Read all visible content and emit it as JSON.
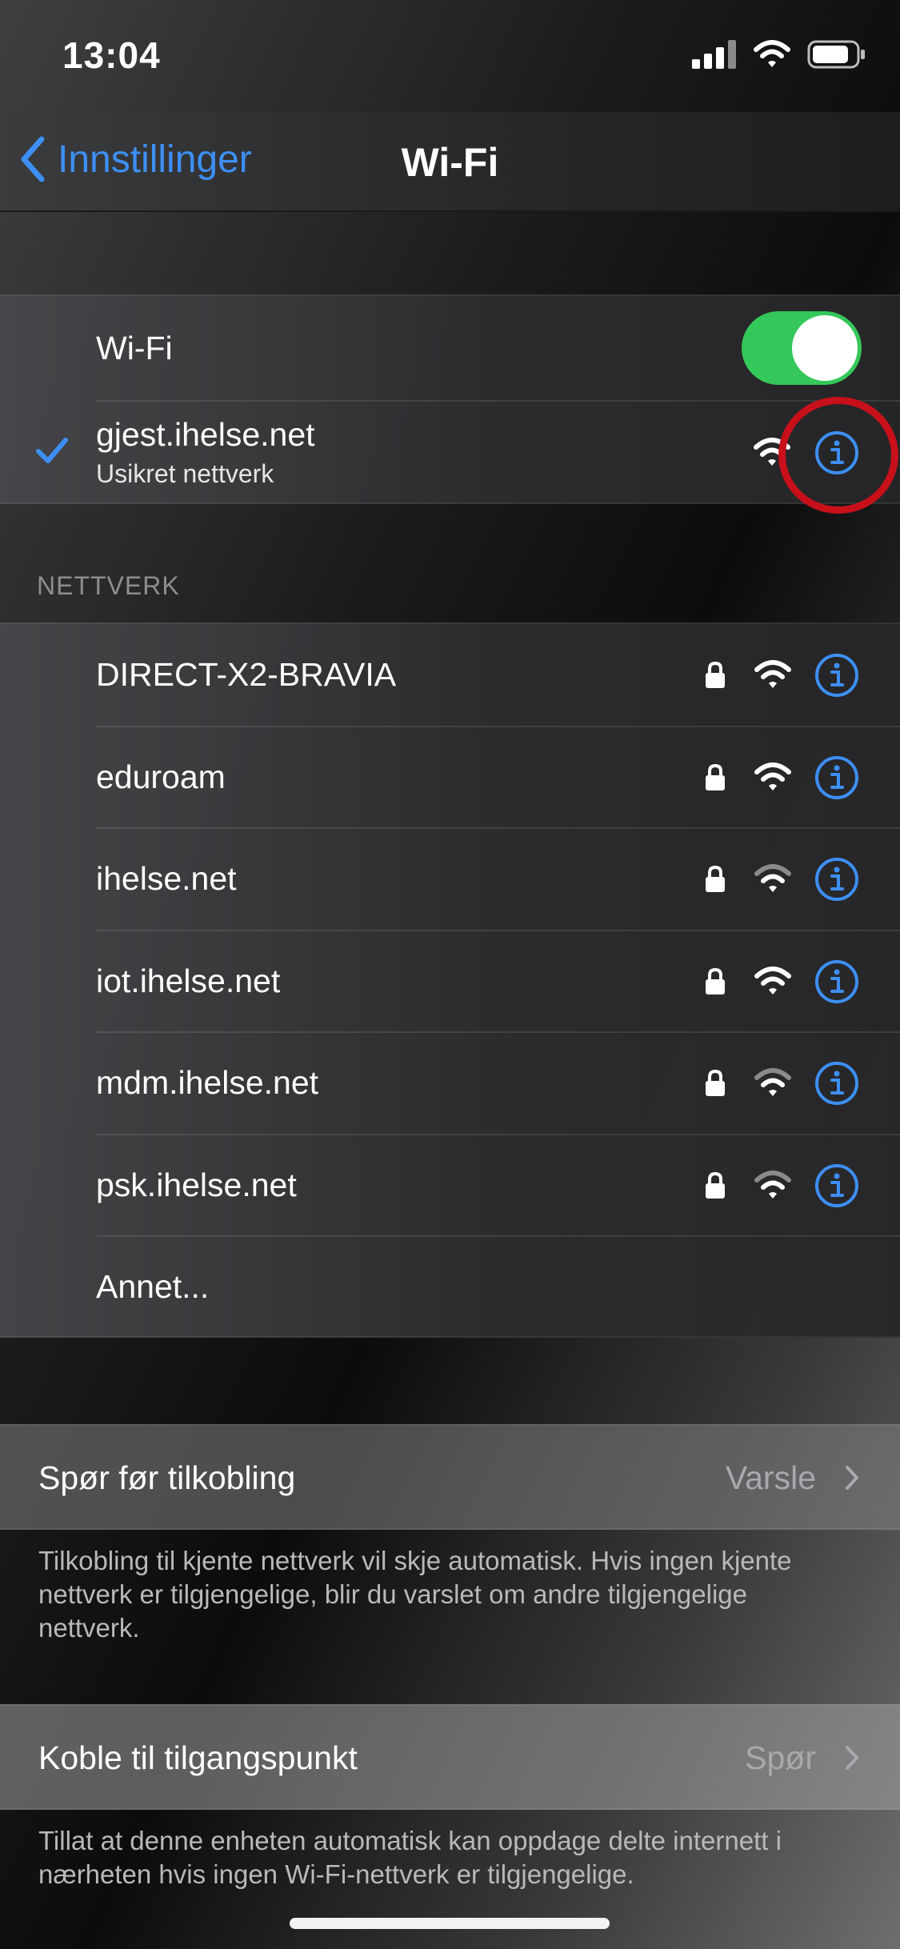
{
  "status_bar": {
    "time": "13:04"
  },
  "nav": {
    "back_label": "Innstillinger",
    "title": "Wi-Fi"
  },
  "wifi_toggle": {
    "label": "Wi-Fi",
    "on": true
  },
  "connected_network": {
    "name": "gjest.ihelse.net",
    "subtitle": "Usikret nettverk",
    "signal": "full",
    "secured": false
  },
  "networks_section": {
    "header": "NETTVERK",
    "networks": [
      {
        "name": "DIRECT-X2-BRAVIA",
        "secured": true,
        "signal": "full"
      },
      {
        "name": "eduroam",
        "secured": true,
        "signal": "full"
      },
      {
        "name": "ihelse.net",
        "secured": true,
        "signal": "weak"
      },
      {
        "name": "iot.ihelse.net",
        "secured": true,
        "signal": "full"
      },
      {
        "name": "mdm.ihelse.net",
        "secured": true,
        "signal": "weak"
      },
      {
        "name": "psk.ihelse.net",
        "secured": true,
        "signal": "weak"
      }
    ],
    "other_label": "Annet..."
  },
  "ask_to_join": {
    "label": "Spør før tilkobling",
    "value": "Varsle",
    "footnote": "Tilkobling til kjente nettverk vil skje automatisk. Hvis ingen kjente nettverk er tilgjengelige, blir du varslet om andre tilgjengelige nettverk."
  },
  "hotspot": {
    "label": "Koble til tilgangspunkt",
    "value": "Spør",
    "footnote": "Tillat at denne enheten automatisk kan oppdage delte internett i nærheten hvis ingen Wi-Fi-nettverk er tilgjengelige."
  },
  "colors": {
    "accent": "#3d8ff5",
    "toggle_on": "#34c759",
    "highlight": "#c8101a"
  },
  "icons": [
    "cellular-signal-icon",
    "wifi-icon",
    "battery-icon",
    "chevron-left-icon",
    "checkmark-icon",
    "lock-icon",
    "info-icon",
    "chevron-right-icon"
  ]
}
